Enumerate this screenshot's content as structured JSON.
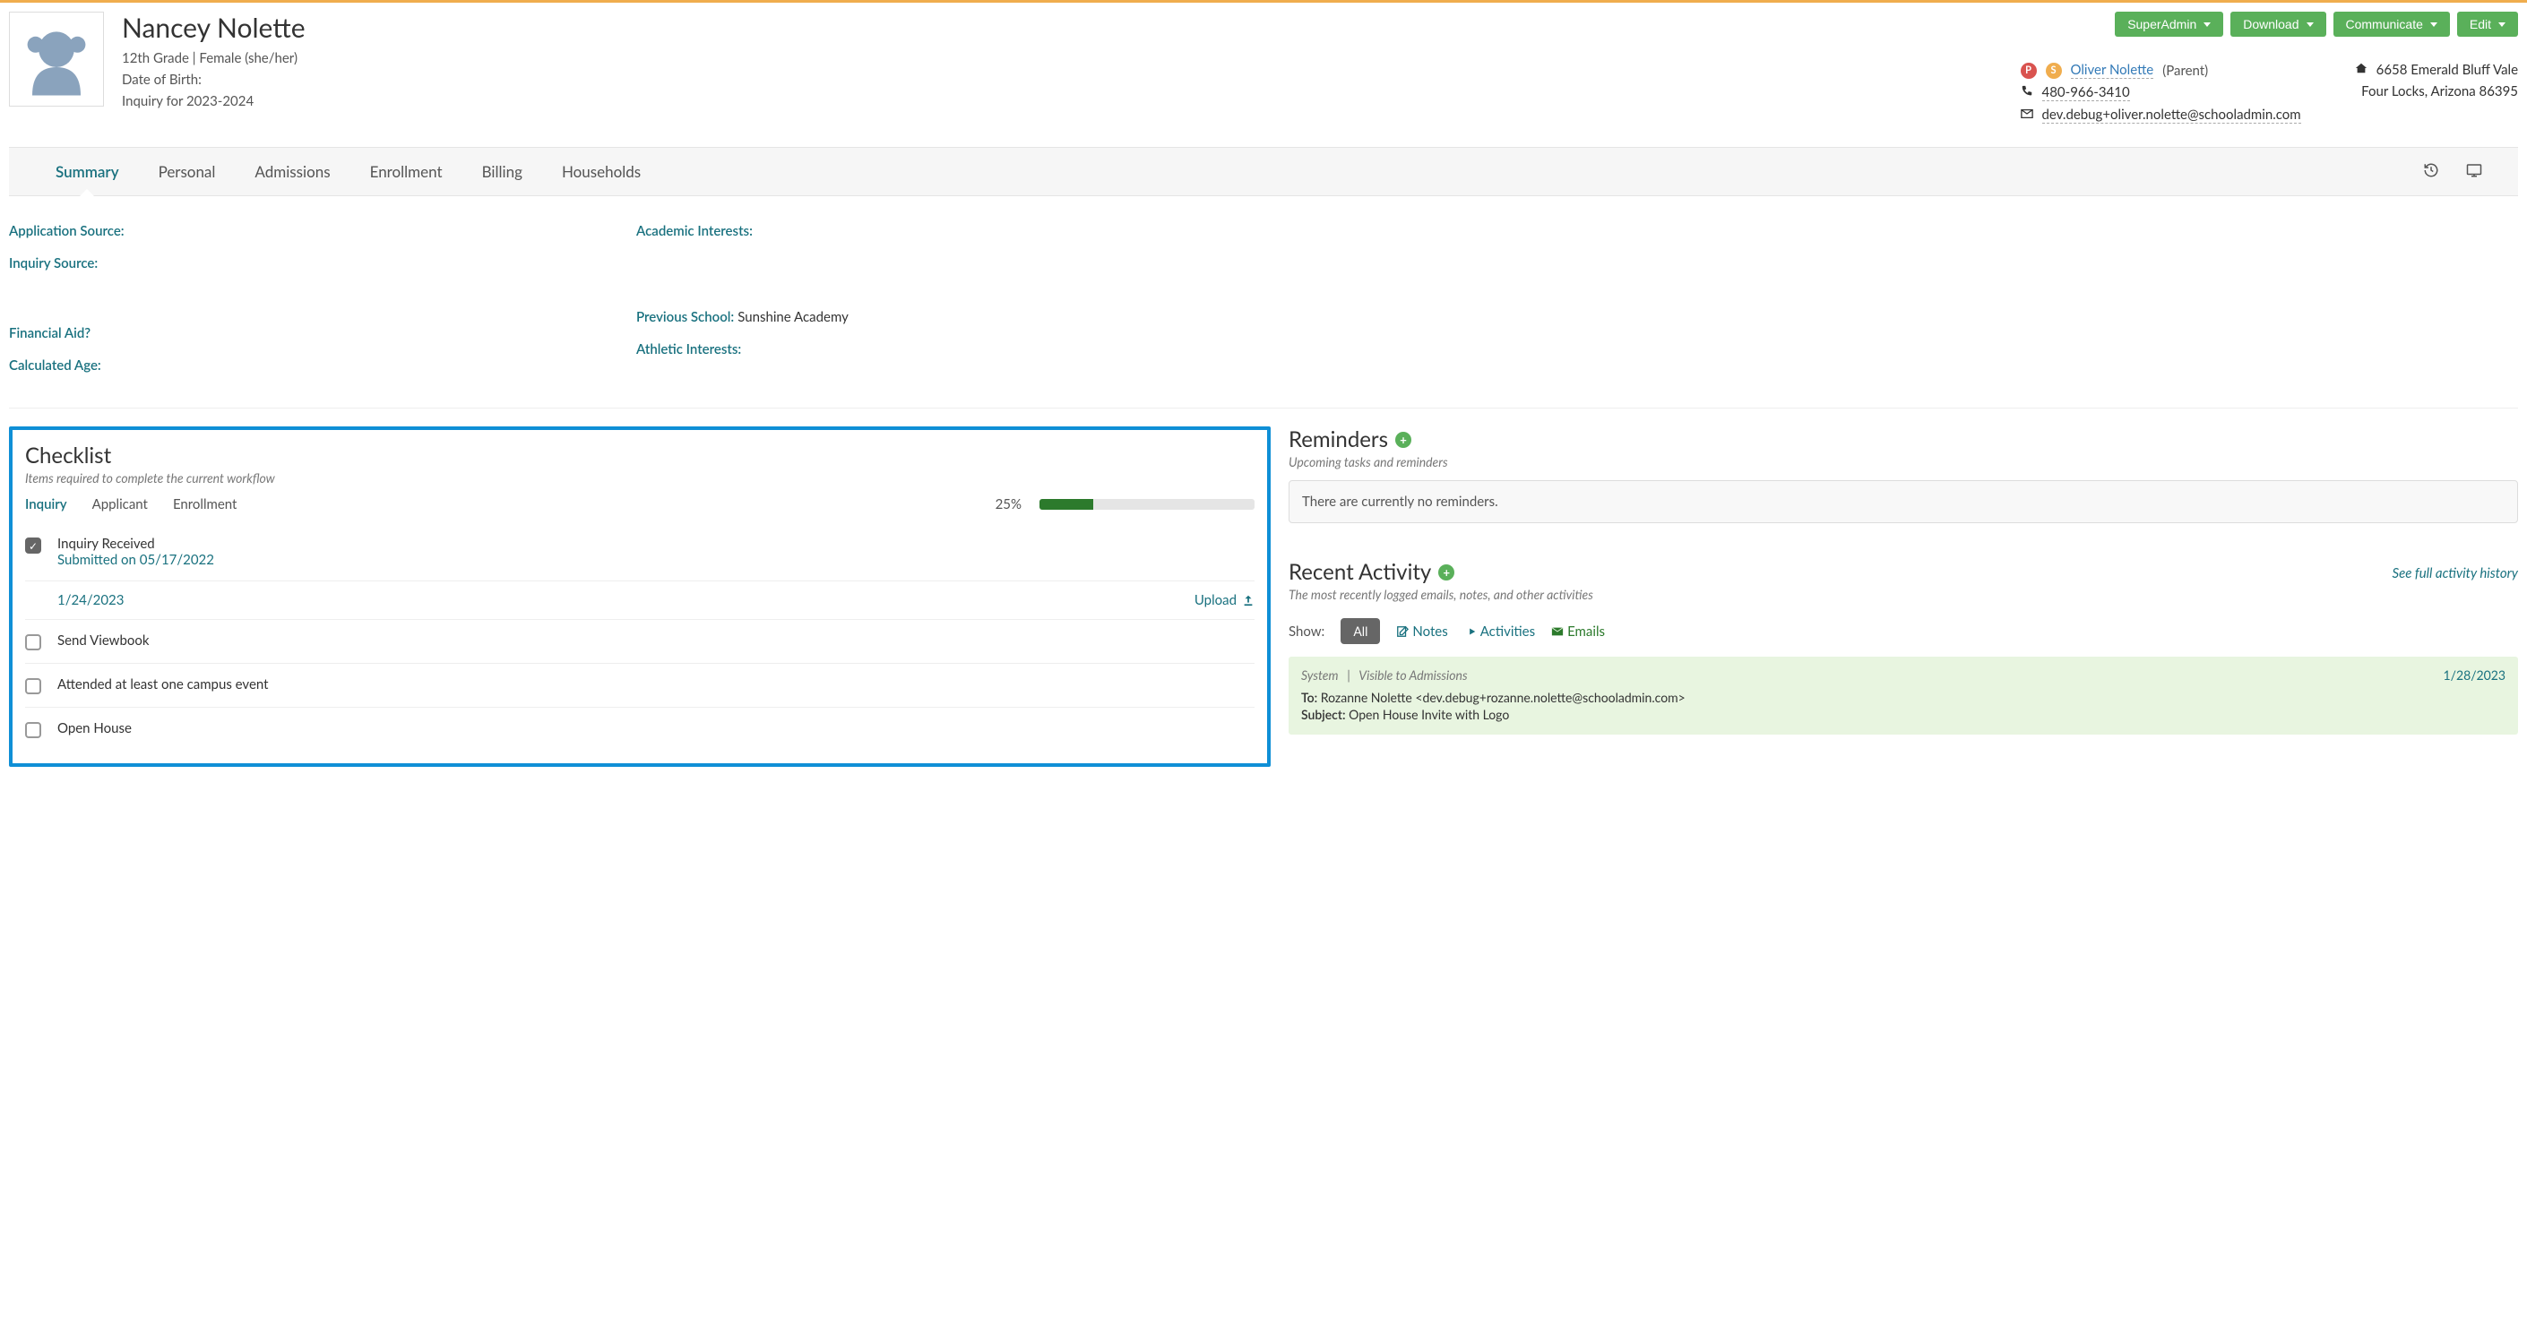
{
  "header": {
    "student_name": "Nancey Nolette",
    "meta_line1": "12th Grade | Female (she/her)",
    "meta_dob_label": "Date of Birth:",
    "meta_status": "Inquiry for 2023-2024",
    "buttons": {
      "superadmin": "SuperAdmin",
      "download": "Download",
      "communicate": "Communicate",
      "edit": "Edit"
    },
    "contact": {
      "name": "Oliver Nolette",
      "relation": "(Parent)",
      "phone": "480-966-3410",
      "email": "dev.debug+oliver.nolette@schooladmin.com"
    },
    "address": {
      "line1": "6658 Emerald Bluff Vale",
      "line2": "Four Locks, Arizona 86395"
    }
  },
  "tabs": [
    "Summary",
    "Personal",
    "Admissions",
    "Enrollment",
    "Billing",
    "Households"
  ],
  "fields": {
    "application_source": {
      "label": "Application Source:",
      "value": ""
    },
    "inquiry_source": {
      "label": "Inquiry Source:",
      "value": ""
    },
    "academic_interests": {
      "label": "Academic Interests:",
      "value": ""
    },
    "financial_aid": {
      "label": "Financial Aid?",
      "value": ""
    },
    "calculated_age": {
      "label": "Calculated Age:",
      "value": ""
    },
    "previous_school": {
      "label": "Previous School:",
      "value": "Sunshine Academy"
    },
    "athletic_interests": {
      "label": "Athletic Interests:",
      "value": ""
    }
  },
  "checklist": {
    "title": "Checklist",
    "subtitle": "Items required to complete the current workflow",
    "tabs": [
      "Inquiry",
      "Applicant",
      "Enrollment"
    ],
    "progress_pct": "25%",
    "progress_val": 25,
    "items": [
      {
        "title": "Inquiry Received",
        "sub": "Submitted on 05/17/2022",
        "checked": true
      },
      {
        "title": "Send Viewbook",
        "checked": false
      },
      {
        "title": "Attended at least one campus event",
        "checked": false
      },
      {
        "title": "Open House",
        "checked": false
      }
    ],
    "date_row": "1/24/2023",
    "upload_label": "Upload"
  },
  "reminders": {
    "title": "Reminders",
    "subtitle": "Upcoming tasks and reminders",
    "empty": "There are currently no reminders."
  },
  "activity": {
    "title": "Recent Activity",
    "subtitle": "The most recently logged emails, notes, and other activities",
    "full_link": "See full activity history",
    "show_label": "Show:",
    "filters": {
      "all": "All",
      "notes": "Notes",
      "activities": "Activities",
      "emails": "Emails"
    },
    "card": {
      "source": "System",
      "visibility": "Visible to Admissions",
      "date": "1/28/2023",
      "to_label": "To:",
      "to_value": "Rozanne Nolette <dev.debug+rozanne.nolette@schooladmin.com>",
      "subject_label": "Subject:",
      "subject_value": "Open House Invite with Logo"
    }
  }
}
